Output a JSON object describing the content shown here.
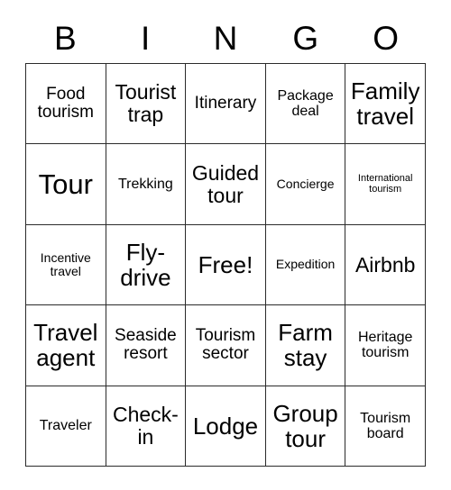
{
  "card": {
    "header_letters": [
      "B",
      "I",
      "N",
      "G",
      "O"
    ],
    "rows": [
      [
        {
          "label": "Food tourism",
          "size": "fs-lg"
        },
        {
          "label": "Tourist trap",
          "size": "fs-xl"
        },
        {
          "label": "Itinerary",
          "size": "fs-lg"
        },
        {
          "label": "Package deal",
          "size": "fs-md"
        },
        {
          "label": "Family travel",
          "size": "fs-xxl"
        }
      ],
      [
        {
          "label": "Tour",
          "size": "fs-huge"
        },
        {
          "label": "Trekking",
          "size": "fs-md"
        },
        {
          "label": "Guided tour",
          "size": "fs-xl"
        },
        {
          "label": "Concierge",
          "size": "fs-sm"
        },
        {
          "label": "International tourism",
          "size": "fs-xs"
        }
      ],
      [
        {
          "label": "Incentive travel",
          "size": "fs-sm"
        },
        {
          "label": "Fly-drive",
          "size": "fs-xxl"
        },
        {
          "label": "Free!",
          "size": "fs-xxl"
        },
        {
          "label": "Expedition",
          "size": "fs-sm"
        },
        {
          "label": "Airbnb",
          "size": "fs-xl"
        }
      ],
      [
        {
          "label": "Travel agent",
          "size": "fs-xxl"
        },
        {
          "label": "Seaside resort",
          "size": "fs-lg"
        },
        {
          "label": "Tourism sector",
          "size": "fs-lg"
        },
        {
          "label": "Farm stay",
          "size": "fs-xxl"
        },
        {
          "label": "Heritage tourism",
          "size": "fs-md"
        }
      ],
      [
        {
          "label": "Traveler",
          "size": "fs-md"
        },
        {
          "label": "Check-in",
          "size": "fs-xl"
        },
        {
          "label": "Lodge",
          "size": "fs-xxl"
        },
        {
          "label": "Group tour",
          "size": "fs-xxl"
        },
        {
          "label": "Tourism board",
          "size": "fs-md"
        }
      ]
    ],
    "free_space_label": "Free!",
    "colors": {
      "border": "#2b2b2b",
      "text": "#000000",
      "background": "#ffffff"
    }
  }
}
